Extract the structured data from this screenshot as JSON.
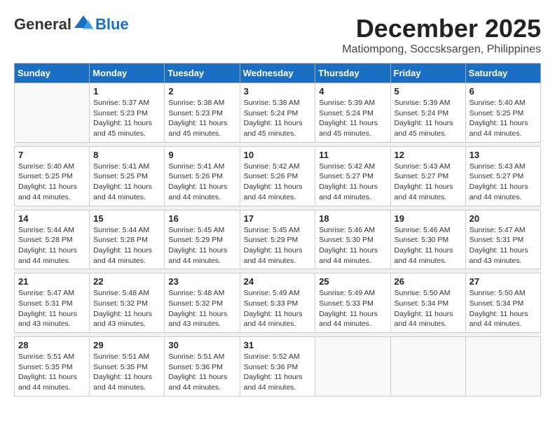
{
  "logo": {
    "general": "General",
    "blue": "Blue"
  },
  "title": {
    "month": "December 2025",
    "location": "Matiompong, Soccsksargen, Philippines"
  },
  "headers": [
    "Sunday",
    "Monday",
    "Tuesday",
    "Wednesday",
    "Thursday",
    "Friday",
    "Saturday"
  ],
  "weeks": [
    [
      {
        "day": "",
        "info": ""
      },
      {
        "day": "1",
        "info": "Sunrise: 5:37 AM\nSunset: 5:23 PM\nDaylight: 11 hours\nand 45 minutes."
      },
      {
        "day": "2",
        "info": "Sunrise: 5:38 AM\nSunset: 5:23 PM\nDaylight: 11 hours\nand 45 minutes."
      },
      {
        "day": "3",
        "info": "Sunrise: 5:38 AM\nSunset: 5:24 PM\nDaylight: 11 hours\nand 45 minutes."
      },
      {
        "day": "4",
        "info": "Sunrise: 5:39 AM\nSunset: 5:24 PM\nDaylight: 11 hours\nand 45 minutes."
      },
      {
        "day": "5",
        "info": "Sunrise: 5:39 AM\nSunset: 5:24 PM\nDaylight: 11 hours\nand 45 minutes."
      },
      {
        "day": "6",
        "info": "Sunrise: 5:40 AM\nSunset: 5:25 PM\nDaylight: 11 hours\nand 44 minutes."
      }
    ],
    [
      {
        "day": "7",
        "info": "Sunrise: 5:40 AM\nSunset: 5:25 PM\nDaylight: 11 hours\nand 44 minutes."
      },
      {
        "day": "8",
        "info": "Sunrise: 5:41 AM\nSunset: 5:25 PM\nDaylight: 11 hours\nand 44 minutes."
      },
      {
        "day": "9",
        "info": "Sunrise: 5:41 AM\nSunset: 5:26 PM\nDaylight: 11 hours\nand 44 minutes."
      },
      {
        "day": "10",
        "info": "Sunrise: 5:42 AM\nSunset: 5:26 PM\nDaylight: 11 hours\nand 44 minutes."
      },
      {
        "day": "11",
        "info": "Sunrise: 5:42 AM\nSunset: 5:27 PM\nDaylight: 11 hours\nand 44 minutes."
      },
      {
        "day": "12",
        "info": "Sunrise: 5:43 AM\nSunset: 5:27 PM\nDaylight: 11 hours\nand 44 minutes."
      },
      {
        "day": "13",
        "info": "Sunrise: 5:43 AM\nSunset: 5:27 PM\nDaylight: 11 hours\nand 44 minutes."
      }
    ],
    [
      {
        "day": "14",
        "info": "Sunrise: 5:44 AM\nSunset: 5:28 PM\nDaylight: 11 hours\nand 44 minutes."
      },
      {
        "day": "15",
        "info": "Sunrise: 5:44 AM\nSunset: 5:28 PM\nDaylight: 11 hours\nand 44 minutes."
      },
      {
        "day": "16",
        "info": "Sunrise: 5:45 AM\nSunset: 5:29 PM\nDaylight: 11 hours\nand 44 minutes."
      },
      {
        "day": "17",
        "info": "Sunrise: 5:45 AM\nSunset: 5:29 PM\nDaylight: 11 hours\nand 44 minutes."
      },
      {
        "day": "18",
        "info": "Sunrise: 5:46 AM\nSunset: 5:30 PM\nDaylight: 11 hours\nand 44 minutes."
      },
      {
        "day": "19",
        "info": "Sunrise: 5:46 AM\nSunset: 5:30 PM\nDaylight: 11 hours\nand 44 minutes."
      },
      {
        "day": "20",
        "info": "Sunrise: 5:47 AM\nSunset: 5:31 PM\nDaylight: 11 hours\nand 43 minutes."
      }
    ],
    [
      {
        "day": "21",
        "info": "Sunrise: 5:47 AM\nSunset: 5:31 PM\nDaylight: 11 hours\nand 43 minutes."
      },
      {
        "day": "22",
        "info": "Sunrise: 5:48 AM\nSunset: 5:32 PM\nDaylight: 11 hours\nand 43 minutes."
      },
      {
        "day": "23",
        "info": "Sunrise: 5:48 AM\nSunset: 5:32 PM\nDaylight: 11 hours\nand 43 minutes."
      },
      {
        "day": "24",
        "info": "Sunrise: 5:49 AM\nSunset: 5:33 PM\nDaylight: 11 hours\nand 44 minutes."
      },
      {
        "day": "25",
        "info": "Sunrise: 5:49 AM\nSunset: 5:33 PM\nDaylight: 11 hours\nand 44 minutes."
      },
      {
        "day": "26",
        "info": "Sunrise: 5:50 AM\nSunset: 5:34 PM\nDaylight: 11 hours\nand 44 minutes."
      },
      {
        "day": "27",
        "info": "Sunrise: 5:50 AM\nSunset: 5:34 PM\nDaylight: 11 hours\nand 44 minutes."
      }
    ],
    [
      {
        "day": "28",
        "info": "Sunrise: 5:51 AM\nSunset: 5:35 PM\nDaylight: 11 hours\nand 44 minutes."
      },
      {
        "day": "29",
        "info": "Sunrise: 5:51 AM\nSunset: 5:35 PM\nDaylight: 11 hours\nand 44 minutes."
      },
      {
        "day": "30",
        "info": "Sunrise: 5:51 AM\nSunset: 5:36 PM\nDaylight: 11 hours\nand 44 minutes."
      },
      {
        "day": "31",
        "info": "Sunrise: 5:52 AM\nSunset: 5:36 PM\nDaylight: 11 hours\nand 44 minutes."
      },
      {
        "day": "",
        "info": ""
      },
      {
        "day": "",
        "info": ""
      },
      {
        "day": "",
        "info": ""
      }
    ]
  ]
}
